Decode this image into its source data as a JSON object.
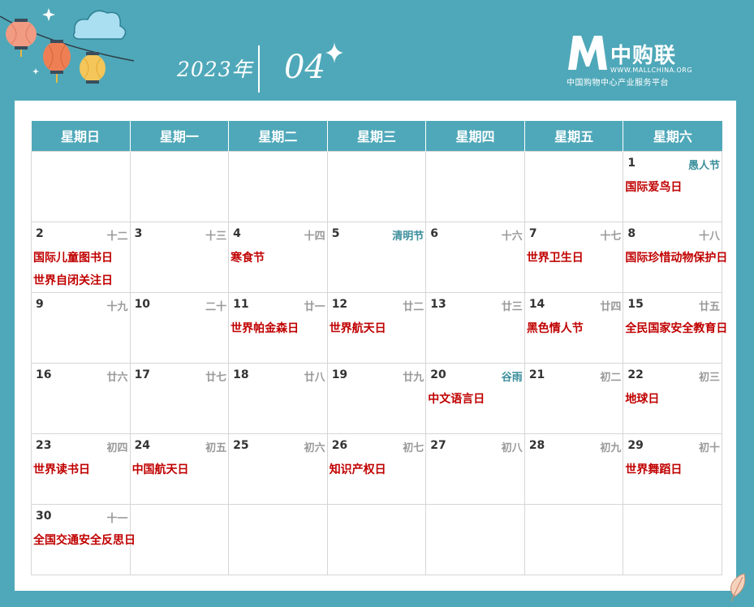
{
  "header": {
    "year": "2023年",
    "month": "04",
    "brand_name": "中购联",
    "brand_url": "WWW.MALLCHINA.ORG",
    "brand_tagline": "中国购物中心产业服务平台"
  },
  "colors": {
    "background": "#4fa8b9",
    "header_cell": "#4fa8b9",
    "event": "#c00000",
    "solar_term": "#3c8f9c",
    "lunar": "#999999"
  },
  "weekdays": [
    "星期日",
    "星期一",
    "星期二",
    "星期三",
    "星期四",
    "星期五",
    "星期六"
  ],
  "weeks": [
    [
      null,
      null,
      null,
      null,
      null,
      null,
      {
        "day": "1",
        "lunar": "愚人节",
        "term": true,
        "events": [
          "国际爱鸟日"
        ]
      }
    ],
    [
      {
        "day": "2",
        "lunar": "十二",
        "events": [
          "国际儿童图书日",
          "世界自闭关注日"
        ]
      },
      {
        "day": "3",
        "lunar": "十三",
        "events": []
      },
      {
        "day": "4",
        "lunar": "十四",
        "events": [
          "寒食节"
        ]
      },
      {
        "day": "5",
        "lunar": "清明节",
        "term": true,
        "events": []
      },
      {
        "day": "6",
        "lunar": "十六",
        "events": []
      },
      {
        "day": "7",
        "lunar": "十七",
        "events": [
          "世界卫生日"
        ]
      },
      {
        "day": "8",
        "lunar": "十八",
        "events": [
          "国际珍惜动物保护日"
        ]
      }
    ],
    [
      {
        "day": "9",
        "lunar": "十九",
        "events": []
      },
      {
        "day": "10",
        "lunar": "二十",
        "events": []
      },
      {
        "day": "11",
        "lunar": "廿一",
        "events": [
          "世界帕金森日"
        ]
      },
      {
        "day": "12",
        "lunar": "廿二",
        "events": [
          "世界航天日"
        ]
      },
      {
        "day": "13",
        "lunar": "廿三",
        "events": []
      },
      {
        "day": "14",
        "lunar": "廿四",
        "events": [
          "黑色情人节"
        ]
      },
      {
        "day": "15",
        "lunar": "廿五",
        "events": [
          "全民国家安全教育日"
        ]
      }
    ],
    [
      {
        "day": "16",
        "lunar": "廿六",
        "events": []
      },
      {
        "day": "17",
        "lunar": "廿七",
        "events": []
      },
      {
        "day": "18",
        "lunar": "廿八",
        "events": []
      },
      {
        "day": "19",
        "lunar": "廿九",
        "events": []
      },
      {
        "day": "20",
        "lunar": "谷雨",
        "term": true,
        "events": [
          "中文语言日"
        ]
      },
      {
        "day": "21",
        "lunar": "初二",
        "events": []
      },
      {
        "day": "22",
        "lunar": "初三",
        "events": [
          "地球日"
        ]
      }
    ],
    [
      {
        "day": "23",
        "lunar": "初四",
        "events": [
          "世界读书日"
        ]
      },
      {
        "day": "24",
        "lunar": "初五",
        "events": [
          "中国航天日"
        ]
      },
      {
        "day": "25",
        "lunar": "初六",
        "events": []
      },
      {
        "day": "26",
        "lunar": "初七",
        "events": [
          "知识产权日"
        ]
      },
      {
        "day": "27",
        "lunar": "初八",
        "events": []
      },
      {
        "day": "28",
        "lunar": "初九",
        "events": []
      },
      {
        "day": "29",
        "lunar": "初十",
        "events": [
          "世界舞蹈日"
        ]
      }
    ],
    [
      {
        "day": "30",
        "lunar": "十一",
        "events": [
          "全国交通安全反思日"
        ]
      },
      null,
      null,
      null,
      null,
      null,
      null
    ]
  ]
}
